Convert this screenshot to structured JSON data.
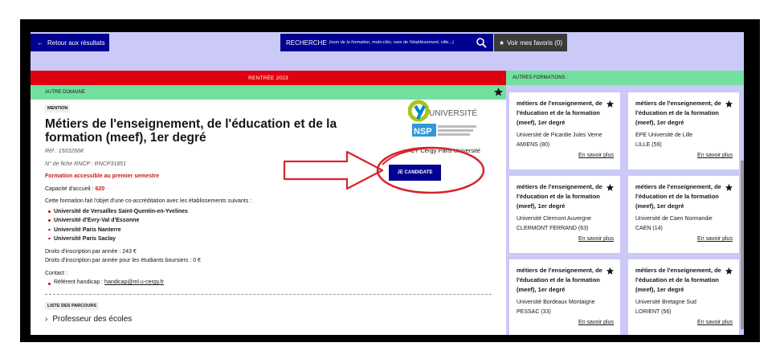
{
  "topbar": {
    "back_label": "Retour aux résultats",
    "search_label": "RECHERCHE",
    "search_placeholder": "(nom de la formation, mots-clés, nom de l'établissement, ville...)",
    "favs_label": "Voir mes favoris (0)"
  },
  "banner": {
    "rentree": "RENTRÉE 2023",
    "domaine": "AUTRE DOMAINE",
    "autres": "AUTRES FORMATIONS :"
  },
  "formation": {
    "mention": "MENTION",
    "title": "Métiers de l'enseignement, de l'éducation et de la formation (meef), 1er degré",
    "ref": "Réf : 1503266K",
    "rncp": "N° de fiche RNCP : RNCP31851",
    "accessible": "Formation accessible au premier semestre",
    "capacite_label": "Capacité d'accueil : ",
    "capacite_value": "620",
    "coacc": "Cette formation fait l'objet d'une co-accréditation avec les établissements suivants :",
    "etablissements": [
      "Université de Versailles Saint-Quentin-en-Yvelines",
      "Université d'Evry-Val d'Essonne",
      "Université Paris Nanterre",
      "Université Paris Saclay"
    ],
    "droits1": "Droits d'inscription par année : 243 €",
    "droits2": "Droits d'inscription par année pour les étudiants boursiers : 0 €",
    "contact": "Contact :",
    "handicap_label": "Référent handicap : ",
    "handicap_email": "handicap@ml.u-cergy.fr",
    "parcours_label": "LISTE DES PARCOURS",
    "parcours_item": "Professeur des écoles",
    "etab_name": "CY Cergy Paris Université",
    "logo_text": "UNIVERSITÉ",
    "candidate_label": "JE CANDIDATE"
  },
  "cards": [
    {
      "title": "métiers de l'enseignement, de l'éducation et de la formation (meef), 1er degré",
      "univ": "Université de Picardie Jules Verne",
      "city": "AMIENS (80)",
      "more": "En savoir plus"
    },
    {
      "title": "métiers de l'enseignement, de l'éducation et de la formation (meef), 1er degré",
      "univ": "EPE Université de Lille",
      "city": "LILLE (59)",
      "more": "En savoir plus"
    },
    {
      "title": "métiers de l'enseignement, de l'éducation et de la formation (meef), 1er degré",
      "univ": "Université Clermont Auvergne",
      "city": "CLERMONT FERRAND (63)",
      "more": "En savoir plus"
    },
    {
      "title": "métiers de l'enseignement, de l'éducation et de la formation (meef), 1er degré",
      "univ": "Université de Caen Normandie",
      "city": "CAEN (14)",
      "more": "En savoir plus"
    },
    {
      "title": "métiers de l'enseignement, de l'éducation et de la formation (meef), 1er degré",
      "univ": "Université Bordeaux Montaigne",
      "city": "PESSAC (33)",
      "more": "En savoir plus"
    },
    {
      "title": "métiers de l'enseignement, de l'éducation et de la formation (meef), 1er degré",
      "univ": "Université Bretagne Sud",
      "city": "LORIENT (56)",
      "more": "En savoir plus"
    }
  ],
  "colors": {
    "primary": "#000091",
    "red": "#e1000f",
    "green": "#73e0a0",
    "lavender": "#cac9f8"
  }
}
